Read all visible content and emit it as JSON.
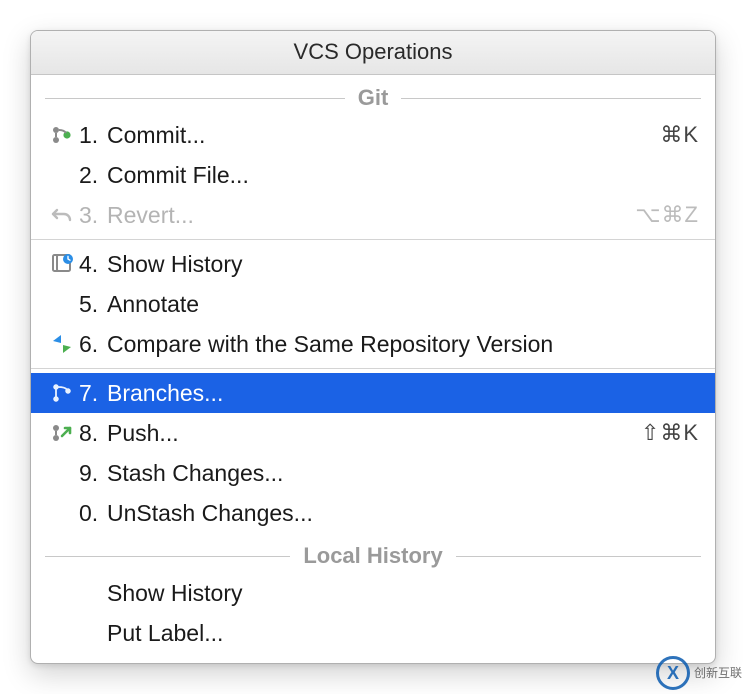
{
  "title": "VCS Operations",
  "sections": {
    "git": {
      "header": "Git",
      "items": [
        {
          "icon": "branch-commit",
          "num": "1.",
          "label": "Commit...",
          "shortcut": "⌘K",
          "disabled": false,
          "selected": false
        },
        {
          "icon": "",
          "num": "2.",
          "label": "Commit File...",
          "shortcut": "",
          "disabled": false,
          "selected": false
        },
        {
          "icon": "undo",
          "num": "3.",
          "label": "Revert...",
          "shortcut": "⌥⌘Z",
          "disabled": true,
          "selected": false
        }
      ],
      "items2": [
        {
          "icon": "history-clock",
          "num": "4.",
          "label": "Show History",
          "shortcut": "",
          "disabled": false,
          "selected": false
        },
        {
          "icon": "",
          "num": "5.",
          "label": "Annotate",
          "shortcut": "",
          "disabled": false,
          "selected": false
        },
        {
          "icon": "compare-arrows",
          "num": "6.",
          "label": "Compare with the Same Repository Version",
          "shortcut": "",
          "disabled": false,
          "selected": false
        }
      ],
      "items3": [
        {
          "icon": "branches",
          "num": "7.",
          "label": "Branches...",
          "shortcut": "",
          "disabled": false,
          "selected": true
        },
        {
          "icon": "push",
          "num": "8.",
          "label": "Push...",
          "shortcut": "⇧⌘K",
          "disabled": false,
          "selected": false
        },
        {
          "icon": "",
          "num": "9.",
          "label": "Stash Changes...",
          "shortcut": "",
          "disabled": false,
          "selected": false
        },
        {
          "icon": "",
          "num": "0.",
          "label": "UnStash Changes...",
          "shortcut": "",
          "disabled": false,
          "selected": false
        }
      ]
    },
    "local": {
      "header": "Local History",
      "items": [
        {
          "icon": "",
          "num": "",
          "label": "Show History",
          "shortcut": "",
          "disabled": false,
          "selected": false
        },
        {
          "icon": "",
          "num": "",
          "label": "Put Label...",
          "shortcut": "",
          "disabled": false,
          "selected": false
        }
      ]
    }
  },
  "watermark": {
    "badge": "X",
    "text": "创新互联"
  }
}
